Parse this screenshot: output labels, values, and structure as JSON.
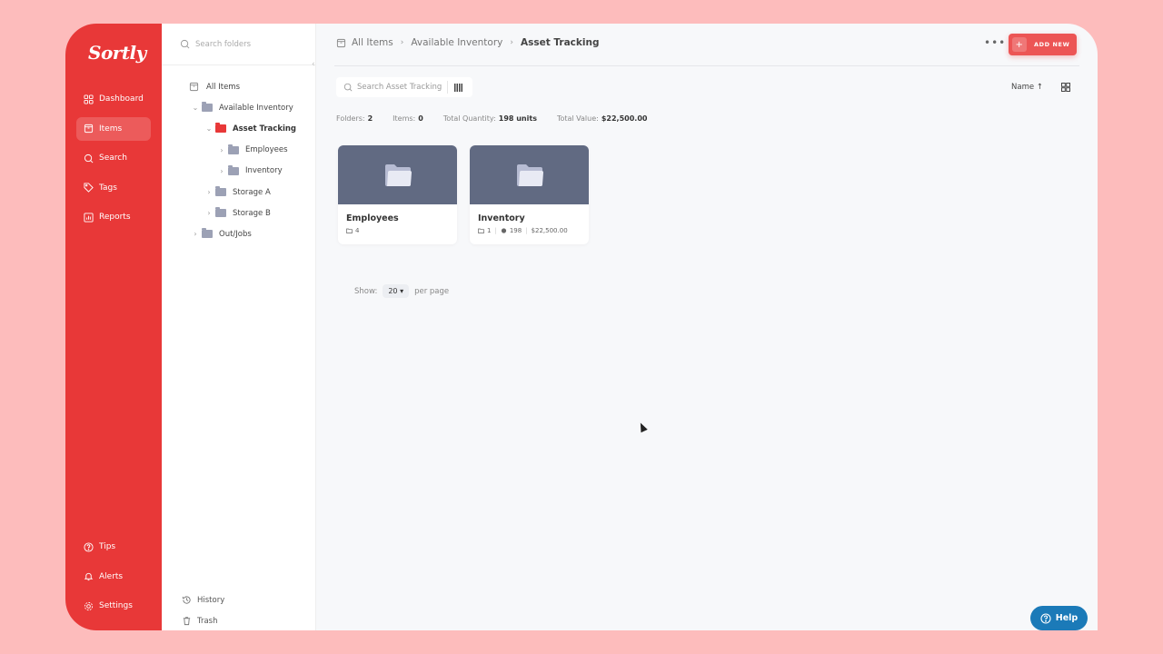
{
  "app": {
    "logo": "Sortly"
  },
  "sidebar": {
    "items": [
      {
        "label": "Dashboard",
        "icon": "dashboard-icon"
      },
      {
        "label": "Items",
        "icon": "items-icon",
        "active": true
      },
      {
        "label": "Search",
        "icon": "search-icon"
      },
      {
        "label": "Tags",
        "icon": "tag-icon"
      },
      {
        "label": "Reports",
        "icon": "reports-icon"
      }
    ],
    "bottom_items": [
      {
        "label": "Tips",
        "icon": "help-circle-icon"
      },
      {
        "label": "Alerts",
        "icon": "bell-icon"
      },
      {
        "label": "Settings",
        "icon": "gear-icon"
      }
    ]
  },
  "folder_panel": {
    "search_placeholder": "Search folders",
    "tree": [
      {
        "label": "All Items"
      },
      {
        "label": "Available Inventory",
        "chevron": "v"
      },
      {
        "label": "Asset Tracking",
        "chevron": "v",
        "selected": true
      },
      {
        "label": "Employees",
        "chevron": ">"
      },
      {
        "label": "Inventory",
        "chevron": ">"
      },
      {
        "label": "Storage A",
        "chevron": ">"
      },
      {
        "label": "Storage B",
        "chevron": ">"
      },
      {
        "label": "Out/Jobs",
        "chevron": ">"
      }
    ],
    "bottom": [
      {
        "label": "History",
        "icon": "history-icon"
      },
      {
        "label": "Trash",
        "icon": "trash-icon"
      }
    ]
  },
  "header": {
    "breadcrumb": [
      "All Items",
      "Available Inventory",
      "Asset Tracking"
    ],
    "more_label": "•••",
    "add_new_label": "ADD NEW"
  },
  "toolbar": {
    "search_placeholder": "Search Asset Tracking",
    "sort_label": "Name ↑"
  },
  "stats": [
    {
      "label": "Folders:",
      "value": "2"
    },
    {
      "label": "Items:",
      "value": "0"
    },
    {
      "label": "Total Quantity:",
      "value": "198 units"
    },
    {
      "label": "Total Value:",
      "value": "$22,500.00"
    }
  ],
  "cards": [
    {
      "title": "Employees",
      "folders": "4"
    },
    {
      "title": "Inventory",
      "folders": "1",
      "quantity": "198",
      "value": "$22,500.00"
    }
  ],
  "pagination": {
    "show_label": "Show:",
    "per_page_value": "20 ▾",
    "per_page_label": "per page"
  },
  "help": {
    "label": "Help"
  },
  "colors": {
    "brand": "#e83838",
    "folder_thumb": "#616a82",
    "help": "#1b7ab8"
  }
}
